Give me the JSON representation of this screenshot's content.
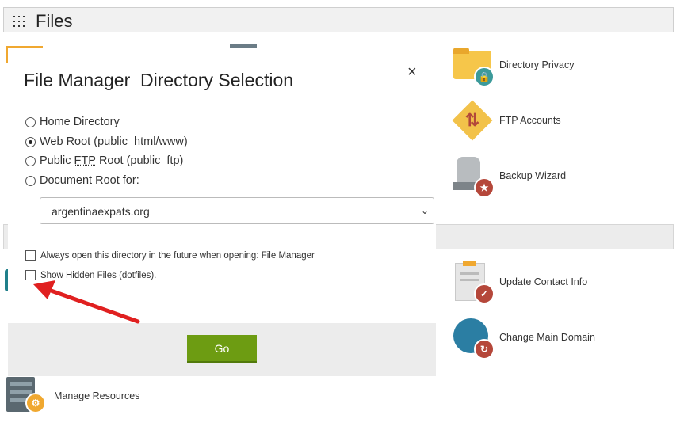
{
  "section": {
    "title": "Files"
  },
  "features_right": [
    {
      "label": "Directory Privacy",
      "icon": "folder-lock-icon"
    },
    {
      "label": "FTP Accounts",
      "icon": "ftp-arrows-icon"
    },
    {
      "label": "Backup Wizard",
      "icon": "backup-drive-icon"
    },
    {
      "label": "Update Contact Info",
      "icon": "clipboard-check-icon"
    },
    {
      "label": "Change Main Domain",
      "icon": "globe-refresh-icon"
    }
  ],
  "features_left": [
    {
      "label": "Manage Resources",
      "icon": "server-gear-icon"
    }
  ],
  "modal": {
    "title": "File Manager  Directory Selection",
    "close": "×",
    "options": [
      {
        "label": "Home Directory",
        "selected": false
      },
      {
        "label_pre": "Web Root (public_html/www)",
        "selected": true
      },
      {
        "pre": "Public ",
        "abbr": "FTP",
        "post": " Root (public_ftp)",
        "selected": false
      },
      {
        "label": "Document Root for:",
        "selected": false
      }
    ],
    "domain_select": {
      "value": "argentinaexpats.org"
    },
    "checkboxes": [
      {
        "label": "Always open this directory in the future when opening: File Manager",
        "checked": false
      },
      {
        "label": "Show Hidden Files (dotfiles).",
        "checked": false
      }
    ],
    "go_label": "Go"
  },
  "colors": {
    "go_button": "#6d9c12",
    "arrow": "#e02020",
    "accent_orange": "#f0a830"
  }
}
